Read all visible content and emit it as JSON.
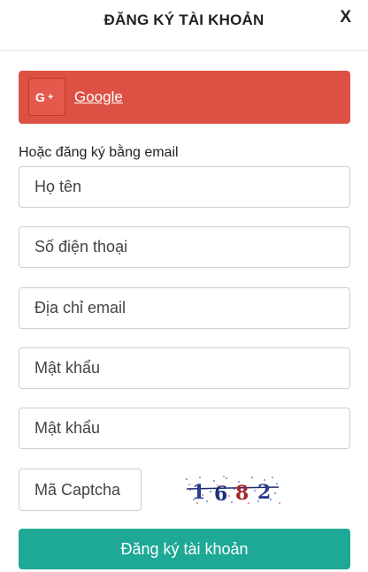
{
  "header": {
    "title": "ĐĂNG KÝ TÀI KHOẢN",
    "close_label": "X"
  },
  "social": {
    "google_label": "Google",
    "google_icon": "google-plus-icon",
    "google_color": "#dd5144"
  },
  "form": {
    "or_label": "Hoặc đăng ký bằng email",
    "fields": {
      "fullname_placeholder": "Họ tên",
      "phone_placeholder": "Số điện thoại",
      "email_placeholder": "Địa chỉ email",
      "password_placeholder": "Mật khẩu",
      "confirm_password_placeholder": "Mật khẩu",
      "captcha_placeholder": "Mã Captcha"
    },
    "captcha_image_text": "1682",
    "submit_label": "Đăng ký tài khoản",
    "submit_color": "#1ea896"
  }
}
